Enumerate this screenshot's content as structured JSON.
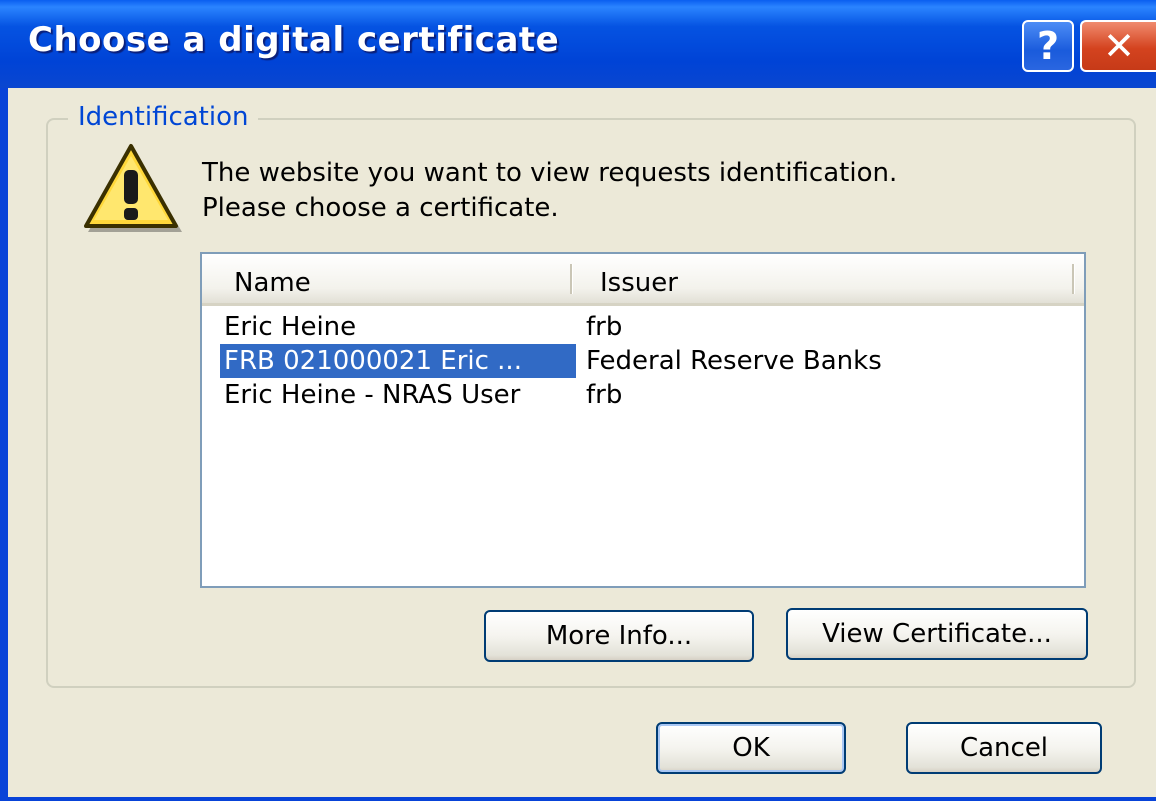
{
  "window": {
    "title": "Choose a digital certificate",
    "help_glyph": "?",
    "close_glyph": "✕"
  },
  "identification": {
    "group_label": "Identification",
    "message_line1": "The website you want to view requests identification.",
    "message_line2": "Please choose a certificate.",
    "icon": "warning-icon"
  },
  "certificate_list": {
    "columns": [
      "Name",
      "Issuer"
    ],
    "rows": [
      {
        "name": "Eric Heine",
        "issuer": "frb",
        "selected": false
      },
      {
        "name": "FRB 021000021 Eric ...",
        "issuer": "Federal Reserve Banks",
        "selected": true
      },
      {
        "name": "Eric Heine - NRAS User",
        "issuer": "frb",
        "selected": false
      }
    ]
  },
  "buttons": {
    "more_info": "More Info...",
    "view_certificate": "View Certificate...",
    "ok": "OK",
    "cancel": "Cancel"
  },
  "colors": {
    "titlebar": "#0043d6",
    "selection": "#316ac5",
    "group_label": "#0046d5",
    "dialog_bg": "#ece9d8"
  }
}
